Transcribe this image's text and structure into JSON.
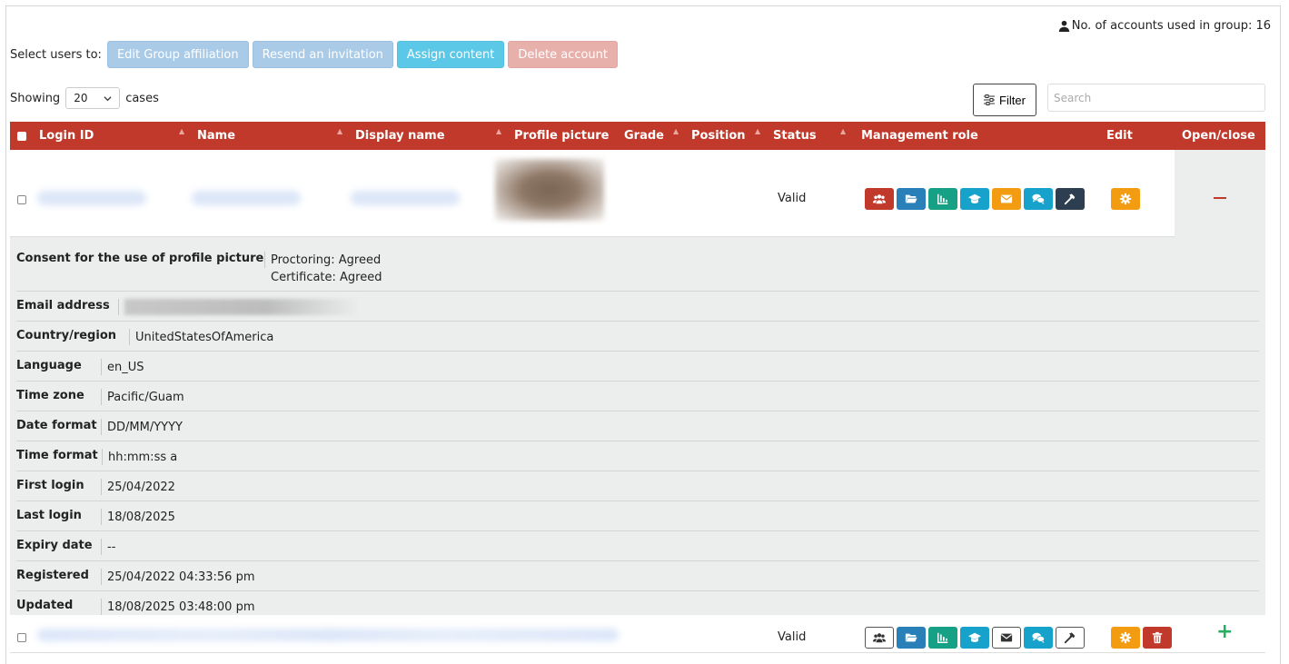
{
  "header": {
    "account_count_label": "No. of accounts used in group: 16"
  },
  "bulk_actions": {
    "label": "Select users to:",
    "edit_group_affiliation": "Edit Group affiliation",
    "resend_invitation": "Resend an invitation",
    "assign_content": "Assign content",
    "delete_account": "Delete account"
  },
  "paging": {
    "showing_label": "Showing",
    "page_size": "20",
    "cases_label": "cases"
  },
  "toolbar": {
    "filter_label": "Filter",
    "search_placeholder": "Search"
  },
  "columns": {
    "login_id": "Login ID",
    "name": "Name",
    "display_name": "Display name",
    "profile_picture": "Profile picture",
    "grade": "Grade",
    "position": "Position",
    "status": "Status",
    "management_role": "Management role",
    "edit": "Edit",
    "open_close": "Open/close"
  },
  "rows": [
    {
      "status": "Valid",
      "role_icons": [
        "users-icon",
        "folder-icon",
        "chart-icon",
        "graduation-cap-icon",
        "envelope-icon",
        "comments-icon",
        "hammer-icon"
      ],
      "edit_icons": [
        "gear-icon"
      ],
      "toggle": "minus-icon"
    },
    {
      "status": "Valid",
      "role_icons": [
        "users-icon",
        "folder-icon",
        "chart-icon",
        "graduation-cap-icon",
        "envelope-icon",
        "comments-icon",
        "hammer-icon"
      ],
      "edit_icons": [
        "gear-icon",
        "trash-icon"
      ],
      "toggle": "plus-icon"
    }
  ],
  "details": {
    "consent_label": "Consent for the use of profile picture",
    "consent_proctoring": "Proctoring: Agreed",
    "consent_certificate": "Certificate: Agreed",
    "email_label": "Email address",
    "country_label": "Country/region",
    "country_value": "UnitedStatesOfAmerica",
    "language_label": "Language",
    "language_value": "en_US",
    "timezone_label": "Time zone",
    "timezone_value": "Pacific/Guam",
    "dateformat_label": "Date format",
    "dateformat_value": "DD/MM/YYYY",
    "timeformat_label": "Time format",
    "timeformat_value": "hh:mm:ss a",
    "firstlogin_label": "First login",
    "firstlogin_value": "25/04/2022",
    "lastlogin_label": "Last login",
    "lastlogin_value": "18/08/2025",
    "expiry_label": "Expiry date",
    "expiry_value": "--",
    "registered_label": "Registered",
    "registered_value": "25/04/2022 04:33:56 pm",
    "updated_label": "Updated",
    "updated_value": "18/08/2025 03:48:00 pm"
  },
  "colors": {
    "header_red": "#c0392b",
    "detail_bg": "#eceeee",
    "plus_green": "#27ae60"
  }
}
